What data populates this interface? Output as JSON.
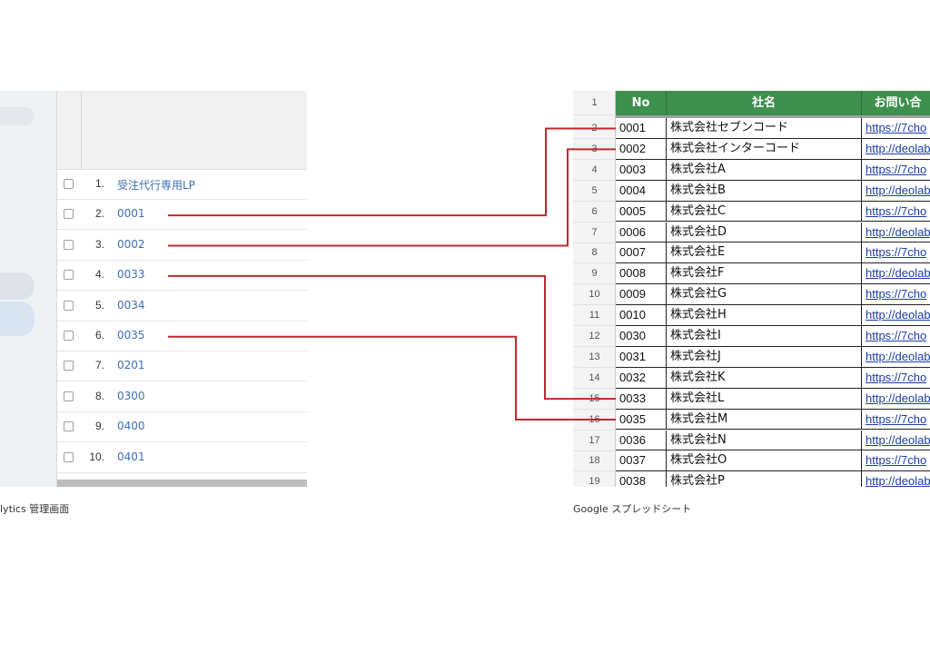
{
  "analytics": {
    "rows": [
      {
        "num": "1.",
        "label": "受注代行専用LP"
      },
      {
        "num": "2.",
        "label": "0001"
      },
      {
        "num": "3.",
        "label": "0002"
      },
      {
        "num": "4.",
        "label": "0033"
      },
      {
        "num": "5.",
        "label": "0034"
      },
      {
        "num": "6.",
        "label": "0035"
      },
      {
        "num": "7.",
        "label": "0201"
      },
      {
        "num": "8.",
        "label": "0300"
      },
      {
        "num": "9.",
        "label": "0400"
      },
      {
        "num": "10.",
        "label": "0401"
      }
    ],
    "caption": "lytics 管理画面"
  },
  "spreadsheet": {
    "header_row_num": "1",
    "columns": [
      "No",
      "社名",
      "お問い合"
    ],
    "rows": [
      {
        "rn": "2",
        "no": "0001",
        "name": "株式会社セブンコード",
        "url": "https://7cho"
      },
      {
        "rn": "3",
        "no": "0002",
        "name": "株式会社インターコード",
        "url": "http://deolab"
      },
      {
        "rn": "4",
        "no": "0003",
        "name": "株式会社A",
        "url": "https://7cho"
      },
      {
        "rn": "5",
        "no": "0004",
        "name": "株式会社B",
        "url": "http://deolab"
      },
      {
        "rn": "6",
        "no": "0005",
        "name": "株式会社C",
        "url": "https://7cho"
      },
      {
        "rn": "7",
        "no": "0006",
        "name": "株式会社D",
        "url": "http://deolab"
      },
      {
        "rn": "8",
        "no": "0007",
        "name": "株式会社E",
        "url": "https://7cho"
      },
      {
        "rn": "9",
        "no": "0008",
        "name": "株式会社F",
        "url": "http://deolab"
      },
      {
        "rn": "10",
        "no": "0009",
        "name": "株式会社G",
        "url": "https://7cho"
      },
      {
        "rn": "11",
        "no": "0010",
        "name": "株式会社H",
        "url": "http://deolab"
      },
      {
        "rn": "12",
        "no": "0030",
        "name": "株式会社I",
        "url": "https://7cho"
      },
      {
        "rn": "13",
        "no": "0031",
        "name": "株式会社J",
        "url": "http://deolab"
      },
      {
        "rn": "14",
        "no": "0032",
        "name": "株式会社K",
        "url": "https://7cho"
      },
      {
        "rn": "15",
        "no": "0033",
        "name": "株式会社L",
        "url": "http://deolab"
      },
      {
        "rn": "16",
        "no": "0035",
        "name": "株式会社M",
        "url": "https://7cho"
      },
      {
        "rn": "17",
        "no": "0036",
        "name": "株式会社N",
        "url": "http://deolab"
      },
      {
        "rn": "18",
        "no": "0037",
        "name": "株式会社O",
        "url": "https://7cho"
      },
      {
        "rn": "19",
        "no": "0038",
        "name": "株式会社P",
        "url": "http://deolab"
      }
    ],
    "caption": "Google スプレッドシート"
  },
  "colors": {
    "connector": "#c0272d",
    "header_green": "#3f8f4f",
    "link_blue": "#1a3da8",
    "analytics_link": "#3d6fb0"
  },
  "connections": [
    {
      "from": "0001",
      "to": "0001"
    },
    {
      "from": "0002",
      "to": "0002"
    },
    {
      "from": "0033",
      "to": "0033"
    },
    {
      "from": "0035",
      "to": "0035"
    }
  ]
}
